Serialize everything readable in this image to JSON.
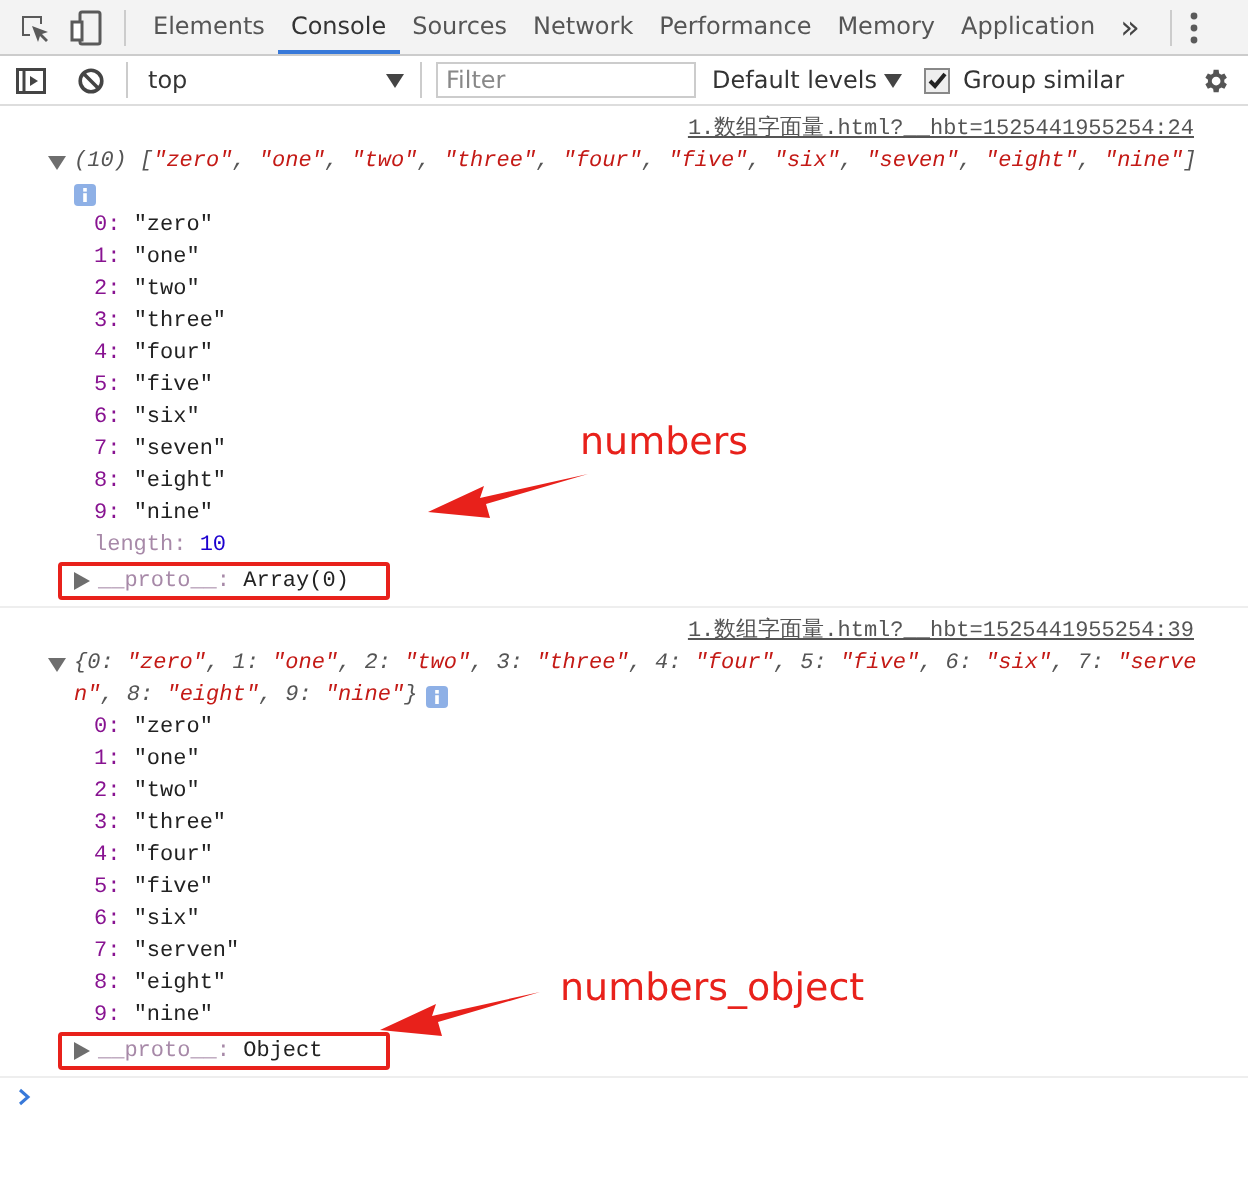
{
  "toolbar": {
    "tabs": [
      {
        "label": "Elements",
        "selected": false
      },
      {
        "label": "Console",
        "selected": true
      },
      {
        "label": "Sources",
        "selected": false
      },
      {
        "label": "Network",
        "selected": false
      },
      {
        "label": "Performance",
        "selected": false
      },
      {
        "label": "Memory",
        "selected": false
      },
      {
        "label": "Application",
        "selected": false
      }
    ],
    "overflow": "»"
  },
  "console_toolbar": {
    "context": "top",
    "filter_placeholder": "Filter",
    "levels": "Default levels",
    "group_similar": {
      "label": "Group similar",
      "checked": true
    }
  },
  "messages": [
    {
      "source": "1.数组字面量.html?__hbt=1525441955254:24",
      "expanded": true,
      "info_icon_own_line": true,
      "summary_lines": [
        [
          {
            "text": "(10) [",
            "kind": "punct"
          },
          {
            "text": "\"zero\"",
            "kind": "string"
          },
          {
            "text": ", ",
            "kind": "punct"
          },
          {
            "text": "\"one\"",
            "kind": "string"
          },
          {
            "text": ", ",
            "kind": "punct"
          },
          {
            "text": "\"two\"",
            "kind": "string"
          },
          {
            "text": ", ",
            "kind": "punct"
          },
          {
            "text": "\"three\"",
            "kind": "string"
          },
          {
            "text": ", ",
            "kind": "punct"
          },
          {
            "text": "\"four\"",
            "kind": "string"
          },
          {
            "text": ", ",
            "kind": "punct"
          },
          {
            "text": "\"five\"",
            "kind": "string"
          },
          {
            "text": ", ",
            "kind": "punct"
          },
          {
            "text": "\"six\"",
            "kind": "string"
          },
          {
            "text": ", ",
            "kind": "punct"
          },
          {
            "text": "\"seven\"",
            "kind": "string"
          },
          {
            "text": ", ",
            "kind": "punct"
          },
          {
            "text": "\"eight\"",
            "kind": "string"
          },
          {
            "text": ", ",
            "kind": "punct"
          },
          {
            "text": "\"nine\"",
            "kind": "string"
          },
          {
            "text": "]",
            "kind": "punct"
          }
        ]
      ],
      "properties": [
        {
          "key": "0:",
          "value": "\"zero\"",
          "kind": "string"
        },
        {
          "key": "1:",
          "value": "\"one\"",
          "kind": "string"
        },
        {
          "key": "2:",
          "value": "\"two\"",
          "kind": "string"
        },
        {
          "key": "3:",
          "value": "\"three\"",
          "kind": "string"
        },
        {
          "key": "4:",
          "value": "\"four\"",
          "kind": "string"
        },
        {
          "key": "5:",
          "value": "\"five\"",
          "kind": "string"
        },
        {
          "key": "6:",
          "value": "\"six\"",
          "kind": "string"
        },
        {
          "key": "7:",
          "value": "\"seven\"",
          "kind": "string"
        },
        {
          "key": "8:",
          "value": "\"eight\"",
          "kind": "string"
        },
        {
          "key": "9:",
          "value": "\"nine\"",
          "kind": "string"
        },
        {
          "key": "length:",
          "value": "10",
          "kind": "meta"
        }
      ],
      "proto": {
        "key": "__proto__:",
        "value": "Array(0)",
        "expanded": false
      },
      "annotation": "numbers"
    },
    {
      "source": "1.数组字面量.html?__hbt=1525441955254:39",
      "expanded": true,
      "info_icon_own_line": false,
      "summary_lines": [
        [
          {
            "text": "{0: ",
            "kind": "punct"
          },
          {
            "text": "\"zero\"",
            "kind": "string"
          },
          {
            "text": ", 1: ",
            "kind": "punct"
          },
          {
            "text": "\"one\"",
            "kind": "string"
          },
          {
            "text": ", 2: ",
            "kind": "punct"
          },
          {
            "text": "\"two\"",
            "kind": "string"
          },
          {
            "text": ", 3: ",
            "kind": "punct"
          },
          {
            "text": "\"three\"",
            "kind": "string"
          },
          {
            "text": ", 4: ",
            "kind": "punct"
          },
          {
            "text": "\"four\"",
            "kind": "string"
          },
          {
            "text": ", 5: ",
            "kind": "punct"
          },
          {
            "text": "\"five\"",
            "kind": "string"
          },
          {
            "text": ", 6: ",
            "kind": "punct"
          },
          {
            "text": "\"six\"",
            "kind": "string"
          },
          {
            "text": ", 7: ",
            "kind": "punct"
          },
          {
            "text": "\"serve",
            "kind": "string"
          }
        ],
        [
          {
            "text": "n\"",
            "kind": "string"
          },
          {
            "text": ", 8: ",
            "kind": "punct"
          },
          {
            "text": "\"eight\"",
            "kind": "string"
          },
          {
            "text": ", 9: ",
            "kind": "punct"
          },
          {
            "text": "\"nine\"",
            "kind": "string"
          },
          {
            "text": "}",
            "kind": "punct"
          }
        ]
      ],
      "properties": [
        {
          "key": "0:",
          "value": "\"zero\"",
          "kind": "string"
        },
        {
          "key": "1:",
          "value": "\"one\"",
          "kind": "string"
        },
        {
          "key": "2:",
          "value": "\"two\"",
          "kind": "string"
        },
        {
          "key": "3:",
          "value": "\"three\"",
          "kind": "string"
        },
        {
          "key": "4:",
          "value": "\"four\"",
          "kind": "string"
        },
        {
          "key": "5:",
          "value": "\"five\"",
          "kind": "string"
        },
        {
          "key": "6:",
          "value": "\"six\"",
          "kind": "string"
        },
        {
          "key": "7:",
          "value": "\"serven\"",
          "kind": "string"
        },
        {
          "key": "8:",
          "value": "\"eight\"",
          "kind": "string"
        },
        {
          "key": "9:",
          "value": "\"nine\"",
          "kind": "string"
        }
      ],
      "proto": {
        "key": "__proto__:",
        "value": "Object",
        "expanded": false
      },
      "annotation": "numbers_object"
    }
  ]
}
